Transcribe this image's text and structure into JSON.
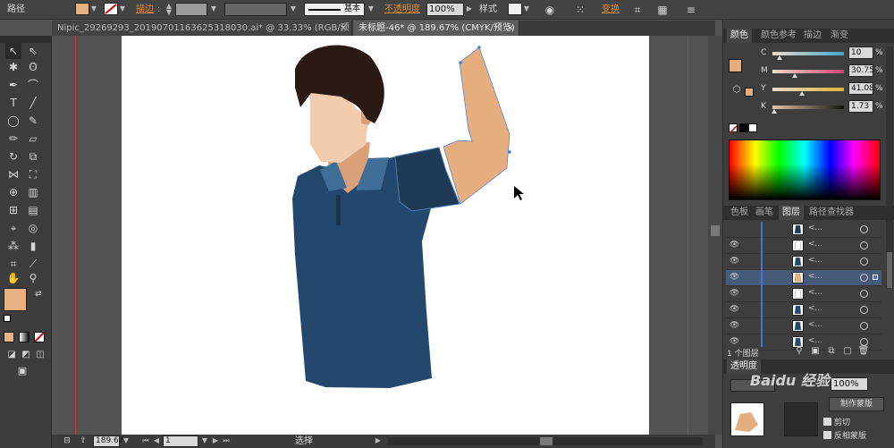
{
  "control_bar": {
    "label": "路径",
    "stroke_label": "描边",
    "brush_label": "基本",
    "opacity_label": "不透明度",
    "opacity_value": "100%",
    "style_label": "样式",
    "transform_label": "变换"
  },
  "tabs": [
    {
      "label": "Nipic_29269293_20190701163625318030.ai* @ 33.33% (RGB/预览)"
    },
    {
      "label": "未标题-46* @ 189.67% (CMYK/预览)"
    }
  ],
  "close_glyph": "×",
  "panels": {
    "color_tabs": [
      "颜色",
      "颜色参考",
      "描边",
      "渐变"
    ],
    "cmyk": [
      {
        "label": "C",
        "value": "10",
        "frac": 0.1
      },
      {
        "label": "M",
        "value": "30.75",
        "frac": 0.31
      },
      {
        "label": "Y",
        "value": "41.08",
        "frac": 0.41
      },
      {
        "label": "K",
        "value": "1.73",
        "frac": 0.02
      }
    ],
    "layers_tabs": [
      "色板",
      "画笔",
      "图层",
      "路径查找器"
    ],
    "layers_rows": [
      {
        "dots": "<..."
      },
      {
        "dots": "<..."
      },
      {
        "dots": "<..."
      },
      {
        "dots": "<..."
      },
      {
        "dots": "<..."
      },
      {
        "dots": "<..."
      },
      {
        "dots": "<..."
      },
      {
        "dots": "<..."
      }
    ],
    "layers_footer": "1 个图层",
    "transparency_tab": "透明度",
    "transparency_value": "100%",
    "make_mask_label": "制作蒙版",
    "clip_label": "剪切",
    "invert_label": "反相蒙版",
    "watermark": "Baidu 经验"
  },
  "status": {
    "zoom": "189.67",
    "page": "1",
    "tool": "选择"
  },
  "colors": {
    "skin": "#e6ad7e",
    "shirt": "#24476e",
    "hair": "#2b1a13",
    "face": "#f2ccad",
    "neck": "#d9a07a",
    "collar": "#3f6f96",
    "sleeve": "#1e3a57",
    "fill_swatch": "#e8b283"
  }
}
